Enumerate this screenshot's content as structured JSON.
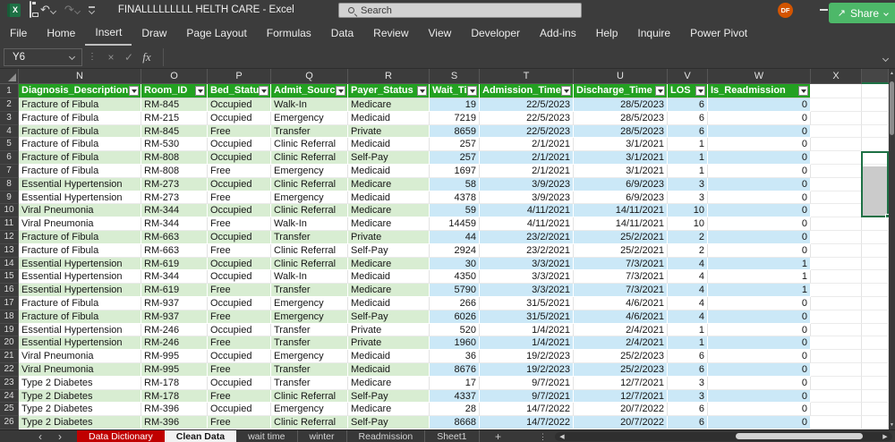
{
  "titlebar": {
    "title": "FINALLLLLLLLL HELTH CARE  -  Excel",
    "search_placeholder": "Search",
    "avatar_initials": "DF"
  },
  "ribbon": {
    "tabs": [
      "File",
      "Home",
      "Insert",
      "Draw",
      "Page Layout",
      "Formulas",
      "Data",
      "Review",
      "View",
      "Developer",
      "Add-ins",
      "Help",
      "Inquire",
      "Power Pivot"
    ],
    "active_tab": "Insert",
    "share_label": "Share"
  },
  "formula_bar": {
    "name_box": "Y6",
    "formula": "",
    "fx_label": "fx"
  },
  "grid": {
    "columns": [
      "N",
      "O",
      "P",
      "Q",
      "R",
      "S",
      "T",
      "U",
      "V",
      "W",
      "X"
    ],
    "selected_column_partial": "Y",
    "header_row": [
      "Diagnosis_Description",
      "Room_ID",
      "Bed_Status",
      "Admit_Source",
      "Payer_Status",
      "Wait_Ti",
      "Admission_Time",
      "Discharge_Time",
      "LOS",
      "Is_Readmission"
    ],
    "first_row_number": 2,
    "rows": [
      [
        "Fracture of Fibula",
        "RM-845",
        "Occupied",
        "Walk-In",
        "Medicare",
        "19",
        "22/5/2023",
        "28/5/2023",
        "6",
        "0"
      ],
      [
        "Fracture of Fibula",
        "RM-215",
        "Occupied",
        "Emergency",
        "Medicaid",
        "7219",
        "22/5/2023",
        "28/5/2023",
        "6",
        "0"
      ],
      [
        "Fracture of Fibula",
        "RM-845",
        "Free",
        "Transfer",
        "Private",
        "8659",
        "22/5/2023",
        "28/5/2023",
        "6",
        "0"
      ],
      [
        "Fracture of Fibula",
        "RM-530",
        "Occupied",
        "Clinic Referral",
        "Medicaid",
        "257",
        "2/1/2021",
        "3/1/2021",
        "1",
        "0"
      ],
      [
        "Fracture of Fibula",
        "RM-808",
        "Occupied",
        "Clinic Referral",
        "Self-Pay",
        "257",
        "2/1/2021",
        "3/1/2021",
        "1",
        "0"
      ],
      [
        "Fracture of Fibula",
        "RM-808",
        "Free",
        "Emergency",
        "Medicaid",
        "1697",
        "2/1/2021",
        "3/1/2021",
        "1",
        "0"
      ],
      [
        "Essential Hypertension",
        "RM-273",
        "Occupied",
        "Clinic Referral",
        "Medicare",
        "58",
        "3/9/2023",
        "6/9/2023",
        "3",
        "0"
      ],
      [
        "Essential Hypertension",
        "RM-273",
        "Free",
        "Emergency",
        "Medicaid",
        "4378",
        "3/9/2023",
        "6/9/2023",
        "3",
        "0"
      ],
      [
        "Viral Pneumonia",
        "RM-344",
        "Occupied",
        "Clinic Referral",
        "Medicare",
        "59",
        "4/11/2021",
        "14/11/2021",
        "10",
        "0"
      ],
      [
        "Viral Pneumonia",
        "RM-344",
        "Free",
        "Walk-In",
        "Medicare",
        "14459",
        "4/11/2021",
        "14/11/2021",
        "10",
        "0"
      ],
      [
        "Fracture of Fibula",
        "RM-663",
        "Occupied",
        "Transfer",
        "Private",
        "44",
        "23/2/2021",
        "25/2/2021",
        "2",
        "0"
      ],
      [
        "Fracture of Fibula",
        "RM-663",
        "Free",
        "Clinic Referral",
        "Self-Pay",
        "2924",
        "23/2/2021",
        "25/2/2021",
        "2",
        "0"
      ],
      [
        "Essential Hypertension",
        "RM-619",
        "Occupied",
        "Clinic Referral",
        "Medicare",
        "30",
        "3/3/2021",
        "7/3/2021",
        "4",
        "1"
      ],
      [
        "Essential Hypertension",
        "RM-344",
        "Occupied",
        "Walk-In",
        "Medicaid",
        "4350",
        "3/3/2021",
        "7/3/2021",
        "4",
        "1"
      ],
      [
        "Essential Hypertension",
        "RM-619",
        "Free",
        "Transfer",
        "Medicare",
        "5790",
        "3/3/2021",
        "7/3/2021",
        "4",
        "1"
      ],
      [
        "Fracture of Fibula",
        "RM-937",
        "Occupied",
        "Emergency",
        "Medicaid",
        "266",
        "31/5/2021",
        "4/6/2021",
        "4",
        "0"
      ],
      [
        "Fracture of Fibula",
        "RM-937",
        "Free",
        "Emergency",
        "Self-Pay",
        "6026",
        "31/5/2021",
        "4/6/2021",
        "4",
        "0"
      ],
      [
        "Essential Hypertension",
        "RM-246",
        "Occupied",
        "Transfer",
        "Private",
        "520",
        "1/4/2021",
        "2/4/2021",
        "1",
        "0"
      ],
      [
        "Essential Hypertension",
        "RM-246",
        "Free",
        "Transfer",
        "Private",
        "1960",
        "1/4/2021",
        "2/4/2021",
        "1",
        "0"
      ],
      [
        "Viral Pneumonia",
        "RM-995",
        "Occupied",
        "Emergency",
        "Medicaid",
        "36",
        "19/2/2023",
        "25/2/2023",
        "6",
        "0"
      ],
      [
        "Viral Pneumonia",
        "RM-995",
        "Free",
        "Transfer",
        "Medicaid",
        "8676",
        "19/2/2023",
        "25/2/2023",
        "6",
        "0"
      ],
      [
        "Type 2 Diabetes",
        "RM-178",
        "Occupied",
        "Transfer",
        "Medicare",
        "17",
        "9/7/2021",
        "12/7/2021",
        "3",
        "0"
      ],
      [
        "Type 2 Diabetes",
        "RM-178",
        "Free",
        "Clinic Referral",
        "Self-Pay",
        "4337",
        "9/7/2021",
        "12/7/2021",
        "3",
        "0"
      ],
      [
        "Type 2 Diabetes",
        "RM-396",
        "Occupied",
        "Emergency",
        "Medicare",
        "28",
        "14/7/2022",
        "20/7/2022",
        "6",
        "0"
      ],
      [
        "Type 2 Diabetes",
        "RM-396",
        "Free",
        "Clinic Referral",
        "Self-Pay",
        "8668",
        "14/7/2022",
        "20/7/2022",
        "6",
        "0"
      ]
    ],
    "selection": {
      "active_cell": "Y6",
      "range": "Y6:Y10"
    }
  },
  "sheet_tabs": {
    "tabs": [
      {
        "label": "Data Dictionary",
        "variant": "red",
        "active": false
      },
      {
        "label": "Clean Data",
        "variant": "normal",
        "active": true
      },
      {
        "label": "wait time",
        "variant": "plain",
        "active": false
      },
      {
        "label": "winter",
        "variant": "plain",
        "active": false
      },
      {
        "label": "Readmission",
        "variant": "plain",
        "active": false
      },
      {
        "label": "Sheet1",
        "variant": "plain",
        "active": false
      }
    ],
    "add_label": "+"
  },
  "colors": {
    "chrome": "#3C3C3C",
    "header_fill": "#23A121",
    "band_green": "#D8EDD2",
    "band_blue": "#CBE8F7",
    "tab_red": "#C00000",
    "selection_border": "#1E7145",
    "share_green": "#4DB869",
    "avatar_orange": "#D35400"
  }
}
